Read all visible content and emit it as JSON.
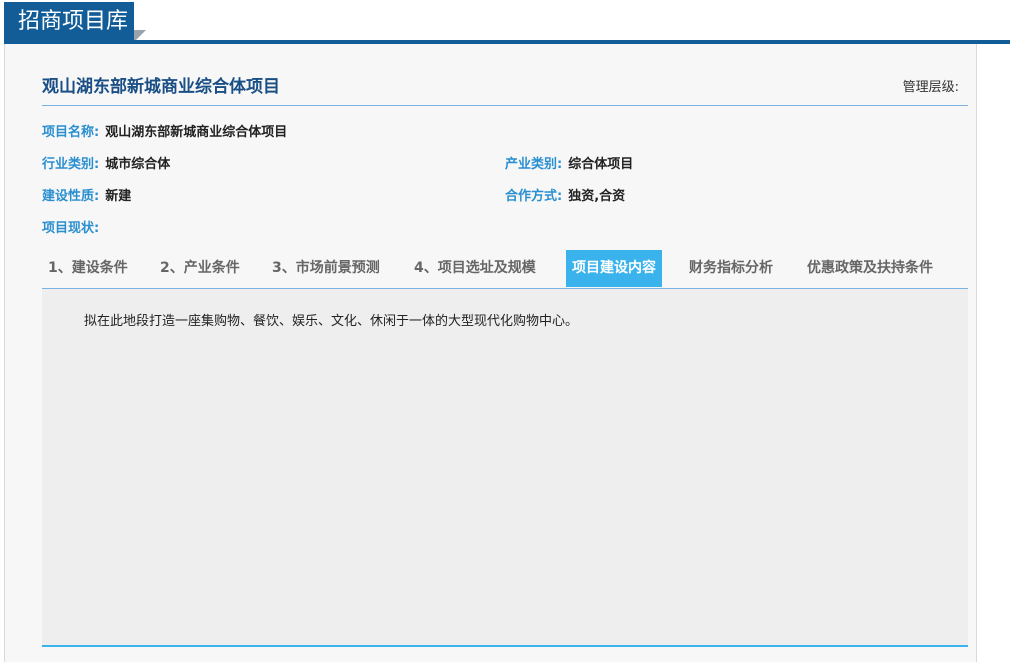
{
  "header": {
    "title": "招商项目库"
  },
  "project": {
    "title": "观山湖东部新城商业综合体项目",
    "management_level_label": "管理层级:",
    "fields": {
      "name": {
        "label": "项目名称:",
        "value": "观山湖东部新城商业综合体项目"
      },
      "industry": {
        "label": "行业类别:",
        "value": "城市综合体"
      },
      "sector": {
        "label": "产业类别:",
        "value": "综合体项目"
      },
      "construction": {
        "label": "建设性质:",
        "value": "新建"
      },
      "cooperation": {
        "label": "合作方式:",
        "value": "独资,合资"
      },
      "status": {
        "label": "项目现状:",
        "value": ""
      }
    }
  },
  "tabs": [
    {
      "label": "1、建设条件"
    },
    {
      "label": "2、产业条件"
    },
    {
      "label": "3、市场前景预测"
    },
    {
      "label": "4、项目选址及规模"
    },
    {
      "label": "项目建设内容",
      "active": true
    },
    {
      "label": "财务指标分析"
    },
    {
      "label": "优惠政策及扶持条件"
    }
  ],
  "content": {
    "text": "拟在此地段打造一座集购物、餐饮、娱乐、文化、休闲于一体的大型现代化购物中心。"
  },
  "colors": {
    "brand": "#125d97",
    "accent": "#3ab3ec",
    "label": "#2a8fd0"
  }
}
